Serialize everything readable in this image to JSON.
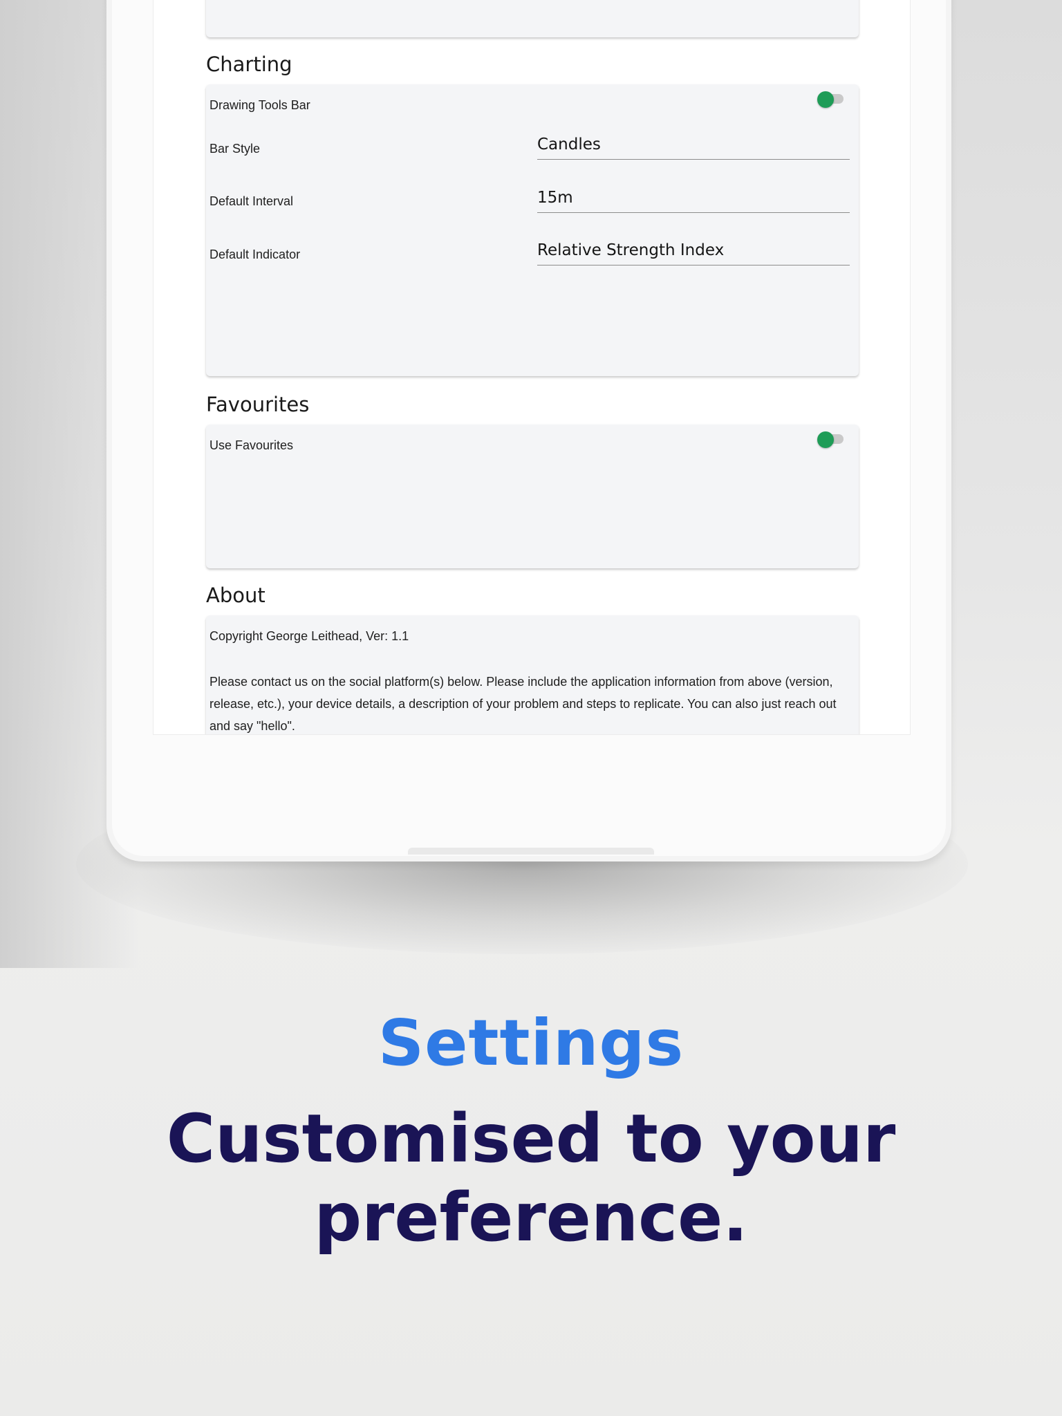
{
  "screen": {
    "sections": {
      "charting": {
        "title": "Charting",
        "drawing_tools_label": "Drawing Tools Bar",
        "bar_style_label": "Bar Style",
        "bar_style_value": "Candles",
        "default_interval_label": "Default Interval",
        "default_interval_value": "15m",
        "default_indicator_label": "Default Indicator",
        "default_indicator_value": "Relative Strength Index"
      },
      "favourites": {
        "title": "Favourites",
        "use_favourites_label": "Use Favourites"
      },
      "about": {
        "title": "About",
        "copyright": "Copyright George Leithead, Ver: 1.1",
        "contact_text": "Please contact us on the social platform(s) below.  Please include the application information from above (version, release, etc.), your device details, a description of your problem and steps to replicate.  You can also just reach out and say \"hello\"."
      }
    },
    "toggle_color": "#1e9c57"
  },
  "caption": {
    "title": "Settings",
    "subtitle_line1": "Customised to your",
    "subtitle_line2": "preference.",
    "title_color": "#2f7ae5",
    "subtitle_color": "#1a1456"
  }
}
